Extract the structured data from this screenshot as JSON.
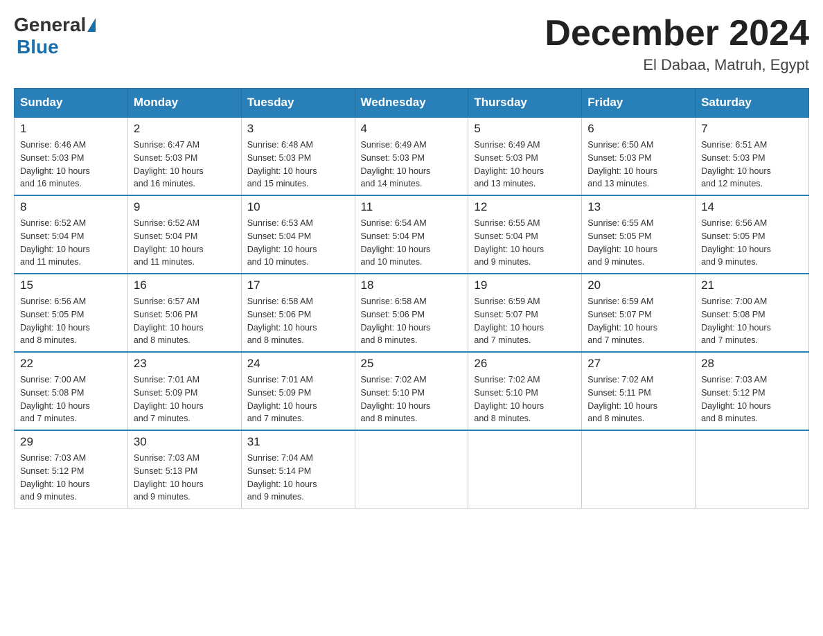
{
  "logo": {
    "general": "General",
    "blue": "Blue"
  },
  "title": "December 2024",
  "subtitle": "El Dabaa, Matruh, Egypt",
  "weekdays": [
    "Sunday",
    "Monday",
    "Tuesday",
    "Wednesday",
    "Thursday",
    "Friday",
    "Saturday"
  ],
  "weeks": [
    [
      {
        "day": "1",
        "sunrise": "6:46 AM",
        "sunset": "5:03 PM",
        "daylight": "10 hours and 16 minutes."
      },
      {
        "day": "2",
        "sunrise": "6:47 AM",
        "sunset": "5:03 PM",
        "daylight": "10 hours and 16 minutes."
      },
      {
        "day": "3",
        "sunrise": "6:48 AM",
        "sunset": "5:03 PM",
        "daylight": "10 hours and 15 minutes."
      },
      {
        "day": "4",
        "sunrise": "6:49 AM",
        "sunset": "5:03 PM",
        "daylight": "10 hours and 14 minutes."
      },
      {
        "day": "5",
        "sunrise": "6:49 AM",
        "sunset": "5:03 PM",
        "daylight": "10 hours and 13 minutes."
      },
      {
        "day": "6",
        "sunrise": "6:50 AM",
        "sunset": "5:03 PM",
        "daylight": "10 hours and 13 minutes."
      },
      {
        "day": "7",
        "sunrise": "6:51 AM",
        "sunset": "5:03 PM",
        "daylight": "10 hours and 12 minutes."
      }
    ],
    [
      {
        "day": "8",
        "sunrise": "6:52 AM",
        "sunset": "5:04 PM",
        "daylight": "10 hours and 11 minutes."
      },
      {
        "day": "9",
        "sunrise": "6:52 AM",
        "sunset": "5:04 PM",
        "daylight": "10 hours and 11 minutes."
      },
      {
        "day": "10",
        "sunrise": "6:53 AM",
        "sunset": "5:04 PM",
        "daylight": "10 hours and 10 minutes."
      },
      {
        "day": "11",
        "sunrise": "6:54 AM",
        "sunset": "5:04 PM",
        "daylight": "10 hours and 10 minutes."
      },
      {
        "day": "12",
        "sunrise": "6:55 AM",
        "sunset": "5:04 PM",
        "daylight": "10 hours and 9 minutes."
      },
      {
        "day": "13",
        "sunrise": "6:55 AM",
        "sunset": "5:05 PM",
        "daylight": "10 hours and 9 minutes."
      },
      {
        "day": "14",
        "sunrise": "6:56 AM",
        "sunset": "5:05 PM",
        "daylight": "10 hours and 9 minutes."
      }
    ],
    [
      {
        "day": "15",
        "sunrise": "6:56 AM",
        "sunset": "5:05 PM",
        "daylight": "10 hours and 8 minutes."
      },
      {
        "day": "16",
        "sunrise": "6:57 AM",
        "sunset": "5:06 PM",
        "daylight": "10 hours and 8 minutes."
      },
      {
        "day": "17",
        "sunrise": "6:58 AM",
        "sunset": "5:06 PM",
        "daylight": "10 hours and 8 minutes."
      },
      {
        "day": "18",
        "sunrise": "6:58 AM",
        "sunset": "5:06 PM",
        "daylight": "10 hours and 8 minutes."
      },
      {
        "day": "19",
        "sunrise": "6:59 AM",
        "sunset": "5:07 PM",
        "daylight": "10 hours and 7 minutes."
      },
      {
        "day": "20",
        "sunrise": "6:59 AM",
        "sunset": "5:07 PM",
        "daylight": "10 hours and 7 minutes."
      },
      {
        "day": "21",
        "sunrise": "7:00 AM",
        "sunset": "5:08 PM",
        "daylight": "10 hours and 7 minutes."
      }
    ],
    [
      {
        "day": "22",
        "sunrise": "7:00 AM",
        "sunset": "5:08 PM",
        "daylight": "10 hours and 7 minutes."
      },
      {
        "day": "23",
        "sunrise": "7:01 AM",
        "sunset": "5:09 PM",
        "daylight": "10 hours and 7 minutes."
      },
      {
        "day": "24",
        "sunrise": "7:01 AM",
        "sunset": "5:09 PM",
        "daylight": "10 hours and 7 minutes."
      },
      {
        "day": "25",
        "sunrise": "7:02 AM",
        "sunset": "5:10 PM",
        "daylight": "10 hours and 8 minutes."
      },
      {
        "day": "26",
        "sunrise": "7:02 AM",
        "sunset": "5:10 PM",
        "daylight": "10 hours and 8 minutes."
      },
      {
        "day": "27",
        "sunrise": "7:02 AM",
        "sunset": "5:11 PM",
        "daylight": "10 hours and 8 minutes."
      },
      {
        "day": "28",
        "sunrise": "7:03 AM",
        "sunset": "5:12 PM",
        "daylight": "10 hours and 8 minutes."
      }
    ],
    [
      {
        "day": "29",
        "sunrise": "7:03 AM",
        "sunset": "5:12 PM",
        "daylight": "10 hours and 9 minutes."
      },
      {
        "day": "30",
        "sunrise": "7:03 AM",
        "sunset": "5:13 PM",
        "daylight": "10 hours and 9 minutes."
      },
      {
        "day": "31",
        "sunrise": "7:04 AM",
        "sunset": "5:14 PM",
        "daylight": "10 hours and 9 minutes."
      },
      null,
      null,
      null,
      null
    ]
  ],
  "labels": {
    "sunrise": "Sunrise:",
    "sunset": "Sunset:",
    "daylight": "Daylight:"
  }
}
